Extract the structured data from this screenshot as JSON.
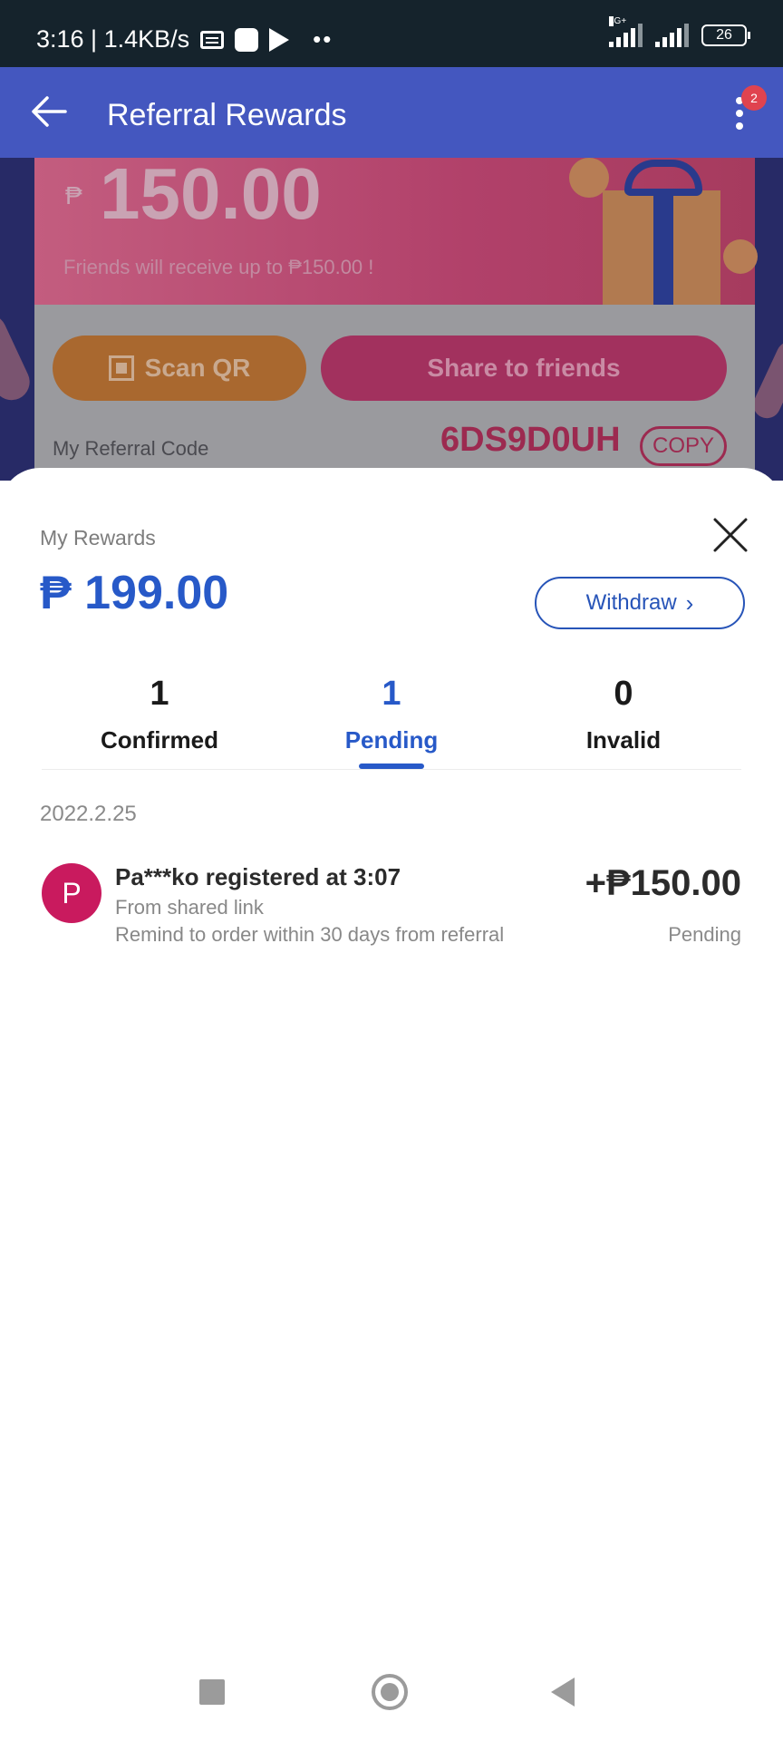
{
  "status_bar": {
    "time_speed": "3:16 | 1.4KB/s",
    "network_label": "4G+",
    "battery": "26"
  },
  "header": {
    "title": "Referral Rewards",
    "notification_count": "2"
  },
  "background": {
    "peso_symbol": "₱",
    "reward_amount": "150.00",
    "friends_receive_text": "Friends will receive up to ₱150.00 !",
    "scan_qr_label": "Scan QR",
    "share_label": "Share to friends",
    "referral_code_label": "My Referral Code",
    "referral_code": "6DS9D0UH",
    "copy_label": "COPY"
  },
  "sheet": {
    "rewards_label": "My Rewards",
    "rewards_amount": "₱ 199.00",
    "withdraw_label": "Withdraw",
    "tabs": [
      {
        "count": "1",
        "label": "Confirmed"
      },
      {
        "count": "1",
        "label": "Pending"
      },
      {
        "count": "0",
        "label": "Invalid"
      }
    ],
    "active_tab": "Pending",
    "date": "2022.2.25",
    "items": [
      {
        "avatar_letter": "P",
        "title": "Pa***ko registered at 3:07",
        "source": "From shared link",
        "remind": "Remind to order within 30 days from referral",
        "amount": "+₱150.00",
        "status": "Pending"
      }
    ]
  },
  "colors": {
    "header_bg": "#4457bf",
    "accent_blue": "#2759c8",
    "avatar_bg": "#c91a5e",
    "status_bar_bg": "#15232c"
  },
  "icons": [
    "back-arrow-icon",
    "more-vertical-icon",
    "close-icon",
    "chevron-right-icon",
    "qr-code-icon",
    "gift-icon"
  ]
}
